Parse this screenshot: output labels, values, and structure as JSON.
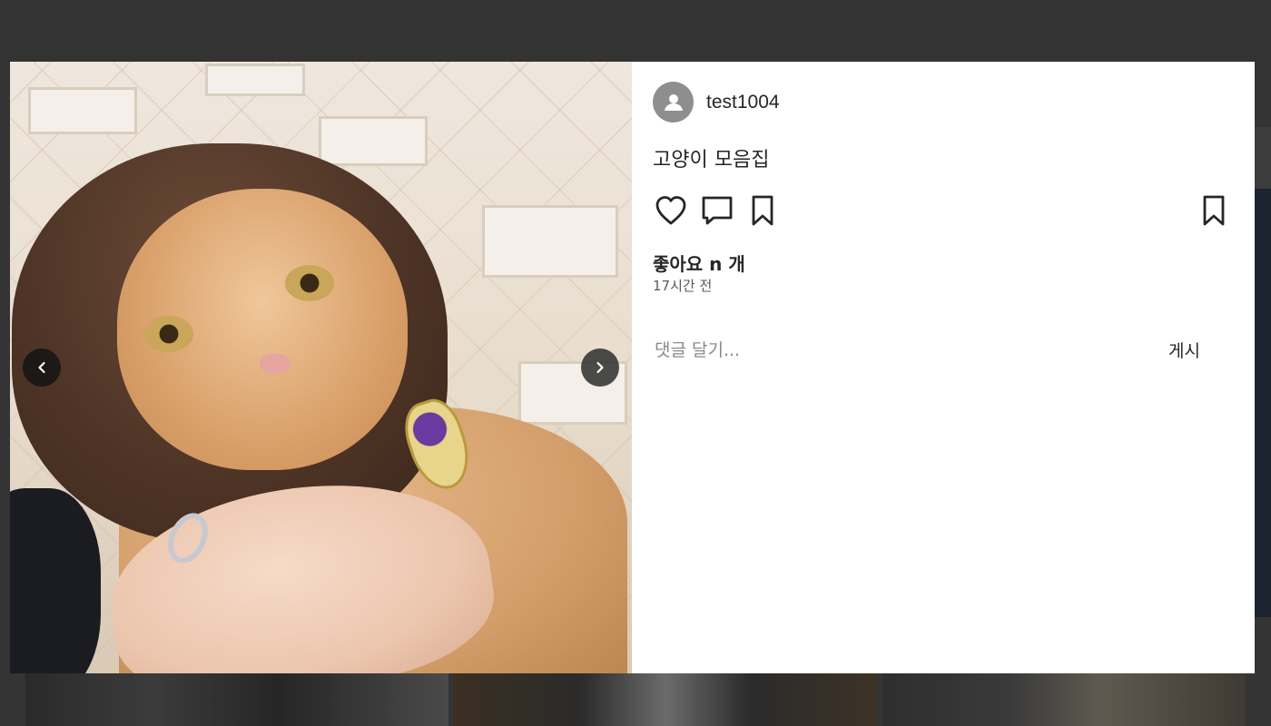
{
  "post": {
    "author": {
      "username": "test1004",
      "avatar_icon": "user-avatar-icon"
    },
    "caption": "고양이 모음집",
    "likes_text": "좋아요 n 개",
    "time_text": "17시간 전",
    "comment": {
      "placeholder": "댓글 달기...",
      "value": "",
      "submit_label": "게시"
    },
    "actions": [
      "heart-icon",
      "comment-icon",
      "bookmark-icon",
      "bookmark-icon"
    ]
  },
  "media": {
    "image_icon": "post-image",
    "prev_icon": "chevron-left-icon",
    "next_icon": "chevron-right-icon"
  },
  "colors": {
    "overlay": "#343434",
    "panel_bg": "#ffffff",
    "text": "#262626",
    "muted": "#8a8a8a",
    "avatar_bg": "#8e8e8e"
  }
}
